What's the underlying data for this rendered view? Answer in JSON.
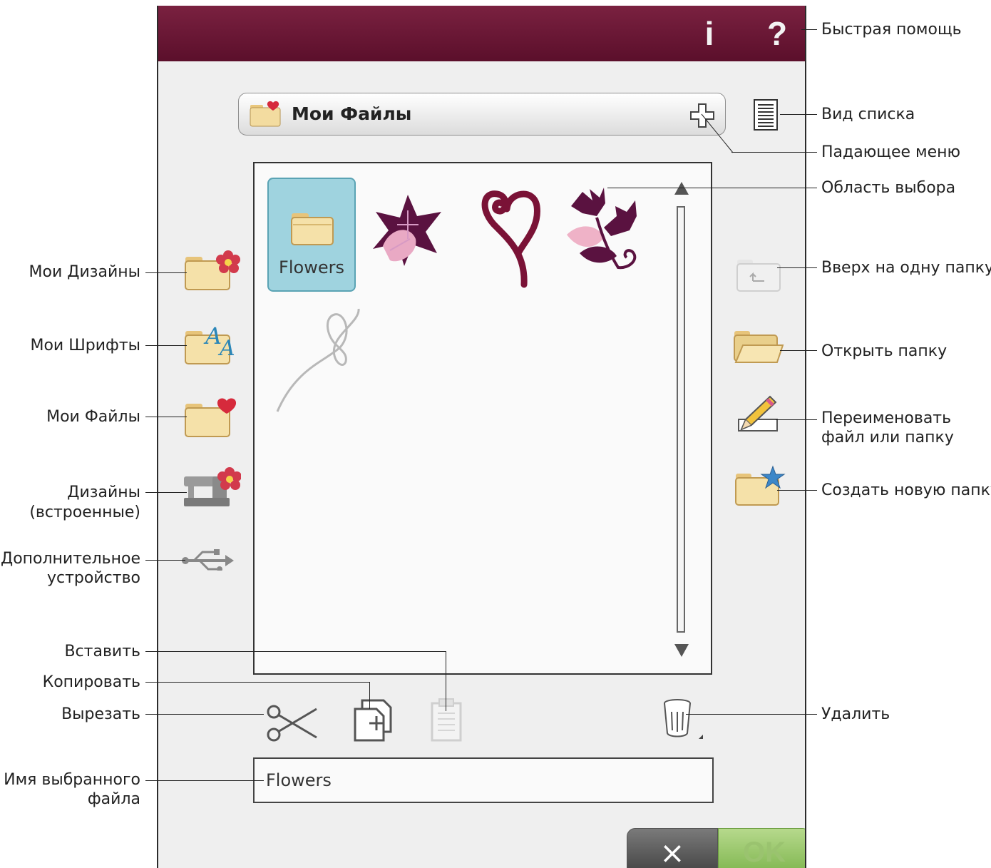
{
  "topbar": {
    "info_label": "i",
    "help_label": "?"
  },
  "dropdown": {
    "title": "Мои Файлы"
  },
  "selection_area": {
    "folder_label": "Flowers"
  },
  "name_field": {
    "value": "Flowers"
  },
  "buttons": {
    "cancel": "×",
    "ok": "OK"
  },
  "left_labels": {
    "my_designs": "Мои Дизайны",
    "my_fonts": "Мои Шрифты",
    "my_files": "Мои Файлы",
    "builtin_designs_1": "Дизайны",
    "builtin_designs_2": "(встроенные)",
    "extra_device_1": "Дополнительное",
    "extra_device_2": "устройство",
    "paste": "Вставить",
    "copy": "Копировать",
    "cut": "Вырезать",
    "selected_name_1": "Имя выбранного",
    "selected_name_2": "файла"
  },
  "right_labels": {
    "quick_help": "Быстрая помощь",
    "list_view": "Вид списка",
    "dropdown_menu": "Падающее меню",
    "selection_area": "Область выбора",
    "up_one_folder": "Вверх на одну папку",
    "open_folder": "Открыть папку",
    "rename_1": "Переименовать",
    "rename_2": "файл или папку",
    "new_folder": "Создать новую папку",
    "delete": "Удалить"
  },
  "colors": {
    "topbar": "#6b1634",
    "folder": "#f3dca0",
    "selected": "#9fd3df",
    "ok": "#8fc45e"
  },
  "icons": [
    "folder-flower-icon",
    "folder-font-icon",
    "folder-heart-icon",
    "sewing-machine-icon",
    "usb-icon",
    "folder-up-icon",
    "open-folder-icon",
    "pencil-icon",
    "new-folder-star-icon",
    "list-view-icon",
    "plus-icon",
    "scissors-icon",
    "copy-icon",
    "paste-icon",
    "trash-icon"
  ]
}
